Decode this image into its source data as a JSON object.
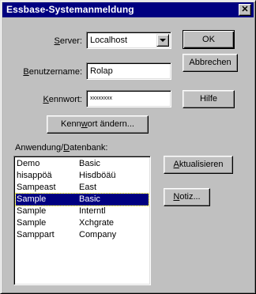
{
  "window": {
    "title": "Essbase-Systemanmeldung",
    "close_glyph": "✕"
  },
  "server": {
    "label_pre": "",
    "label_accel": "S",
    "label_post": "erver:",
    "value": "Localhost"
  },
  "username": {
    "label_pre": "",
    "label_accel": "B",
    "label_post": "enutzername:",
    "value": "Rolap"
  },
  "password": {
    "label_pre": "",
    "label_accel": "K",
    "label_post": "ennwort:",
    "value": "xxxxxxxx"
  },
  "buttons": {
    "ok": "OK",
    "cancel": "Abbrechen",
    "help": "Hilfe",
    "change_password_pre": "Kenn",
    "change_password_accel": "w",
    "change_password_post": "ort ändern...",
    "refresh_pre": "",
    "refresh_accel": "A",
    "refresh_post": "ktualisieren",
    "note_pre": "",
    "note_accel": "N",
    "note_post": "otiz..."
  },
  "app_db": {
    "label_pre": "Anwendung/",
    "label_accel": "D",
    "label_post": "atenbank:",
    "rows": [
      {
        "app": "Demo",
        "db": "Basic",
        "selected": false
      },
      {
        "app": "hisappöä",
        "db": "Hisdböäü",
        "selected": false
      },
      {
        "app": "Sampeast",
        "db": "East",
        "selected": false
      },
      {
        "app": "Sample",
        "db": "Basic",
        "selected": true
      },
      {
        "app": "Sample",
        "db": "Interntl",
        "selected": false
      },
      {
        "app": "Sample",
        "db": "Xchgrate",
        "selected": false
      },
      {
        "app": "Samppart",
        "db": "Company",
        "selected": false
      }
    ]
  },
  "colors": {
    "title_bar": "#000080",
    "selection": "#000080",
    "dialog_face": "#c0c0c0"
  }
}
